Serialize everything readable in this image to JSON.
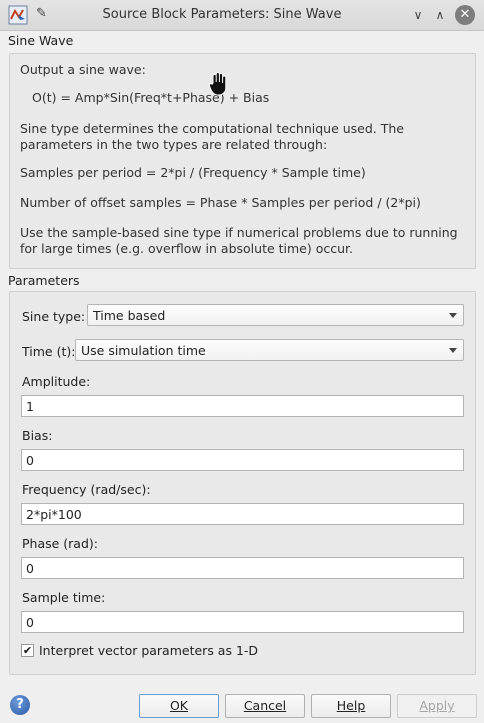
{
  "window": {
    "title": "Source Block Parameters: Sine Wave",
    "pin_icon": "pin-icon",
    "minimize_glyph": "∨",
    "maximize_glyph": "∧",
    "close_glyph": "✕"
  },
  "block_section": {
    "label": "Sine Wave",
    "description": [
      "Output a sine wave:",
      "O(t) = Amp*Sin(Freq*t+Phase) + Bias",
      "Sine type determines the computational technique used. The parameters in the two types are related through:",
      "Samples per period = 2*pi / (Frequency * Sample time)",
      "Number of offset samples = Phase * Samples per period / (2*pi)",
      "Use the sample-based sine type if numerical problems due to running for large times (e.g. overflow in absolute time) occur."
    ]
  },
  "parameters": {
    "label": "Parameters",
    "sine_type": {
      "label": "Sine type:",
      "value": "Time based"
    },
    "time": {
      "label": "Time (t):",
      "value": "Use simulation time"
    },
    "amplitude": {
      "label": "Amplitude:",
      "value": "1"
    },
    "bias": {
      "label": "Bias:",
      "value": "0"
    },
    "frequency": {
      "label": "Frequency (rad/sec):",
      "value": "2*pi*100"
    },
    "phase": {
      "label": "Phase (rad):",
      "value": "0"
    },
    "sample_time": {
      "label": "Sample time:",
      "value": "0"
    },
    "interpret_vector": {
      "label": "Interpret vector parameters as 1-D",
      "checked": true,
      "check_glyph": "✔"
    }
  },
  "buttons": {
    "ok": "OK",
    "cancel": "Cancel",
    "help": "Help",
    "apply": "Apply",
    "help_icon_glyph": "?"
  }
}
